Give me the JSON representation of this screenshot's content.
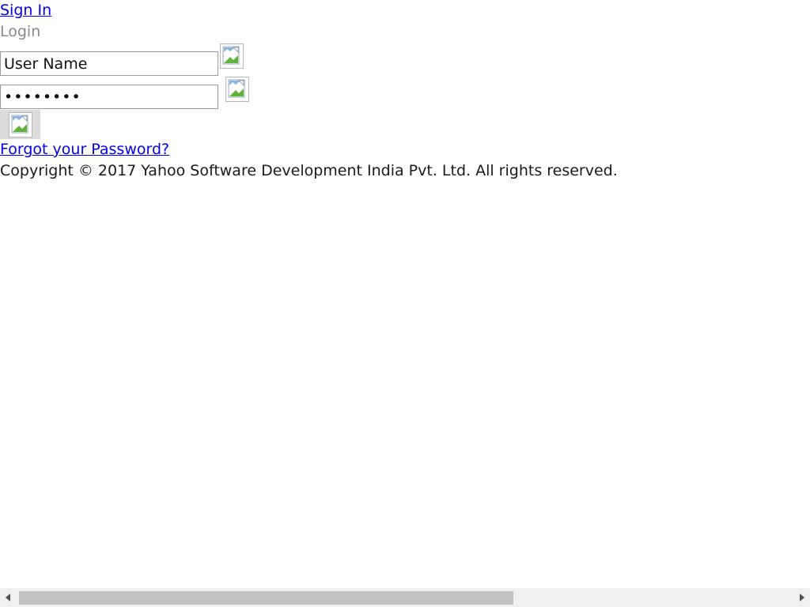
{
  "header": {
    "signin_link": "Sign In",
    "login_heading": "Login"
  },
  "form": {
    "username_value": "User Name",
    "password_value": "••••••••",
    "username_icon": "broken-image-icon",
    "password_icon": "broken-image-icon",
    "submit_icon": "broken-image-icon"
  },
  "links": {
    "forgot_password": "Forgot your Password?"
  },
  "footer": {
    "copyright": "Copyright © 2017 Yahoo Software Development India Pvt. Ltd. All rights reserved."
  },
  "scrollbar": {
    "horizontal_thumb_fraction": 0.64
  },
  "colors": {
    "link": "#0000ee",
    "heading_gray": "#8a8a8a",
    "button_bg": "#dcdcdc",
    "image_green": "#5fb33a",
    "image_blue": "#8ab4e0"
  }
}
